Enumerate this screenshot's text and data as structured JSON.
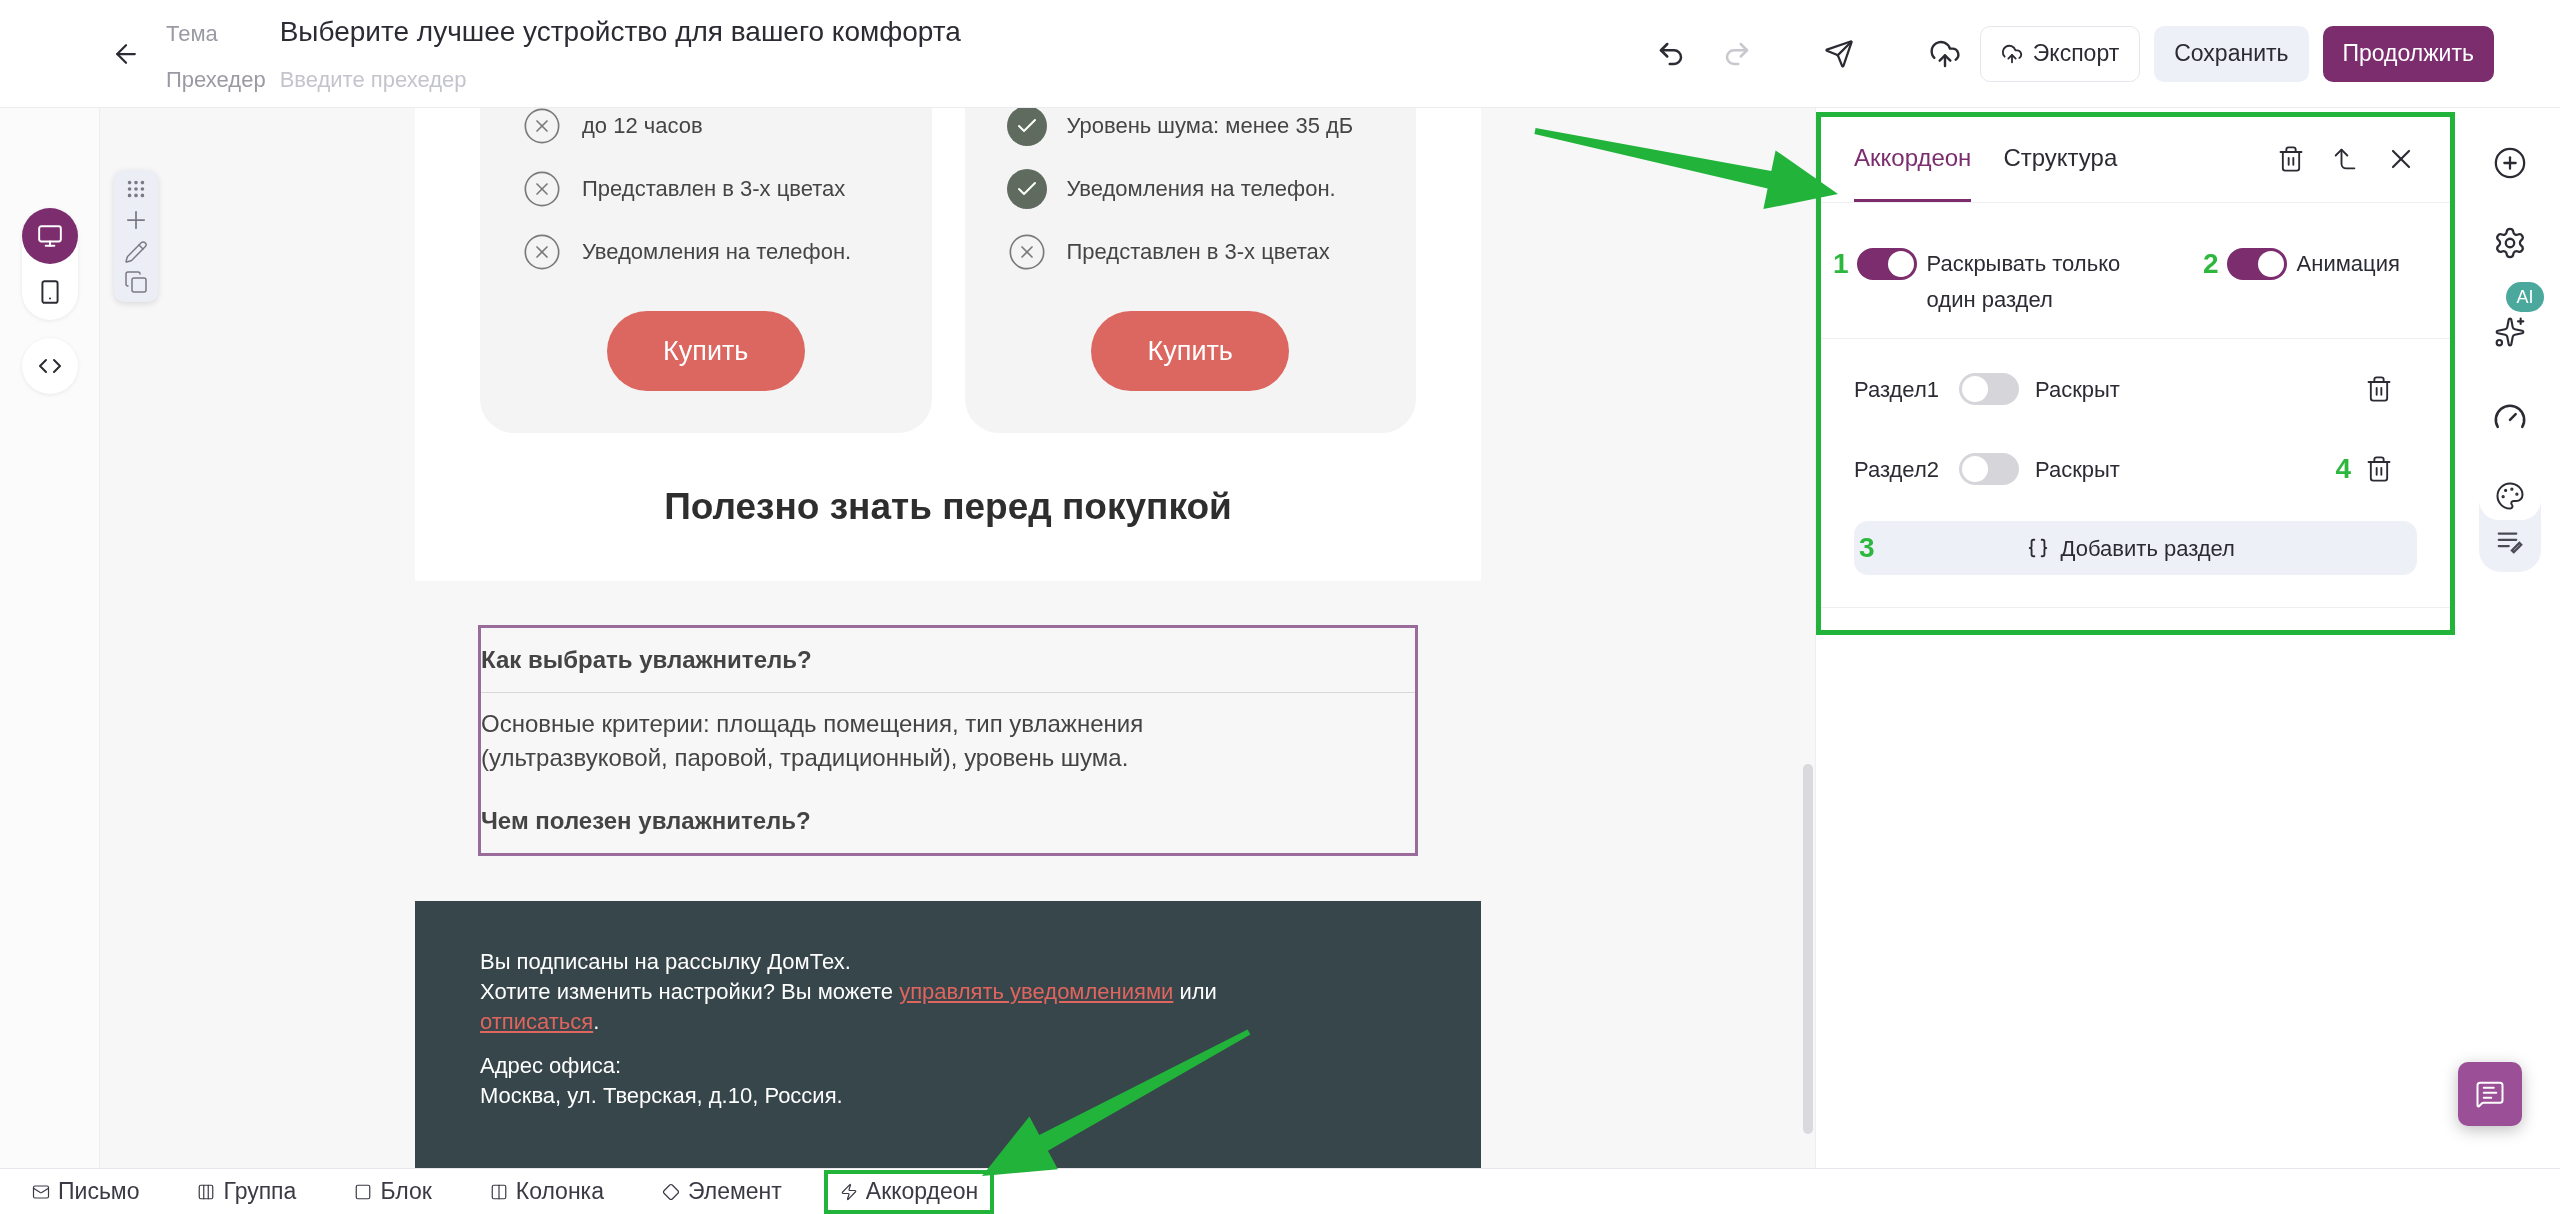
{
  "topbar": {
    "subject_label": "Тема",
    "subject": "Выберите лучшее устройство для вашего комфорта",
    "preheader_label": "Прехедер",
    "preheader_placeholder": "Введите прехедер",
    "redo_disabled": true,
    "buttons": [
      {
        "label": "Экспорт",
        "kind": "export"
      },
      {
        "label": "Сохранить",
        "kind": "secondary"
      },
      {
        "label": "Продолжить",
        "kind": "primary"
      }
    ]
  },
  "devices": [
    {
      "kind": "desktop",
      "selected": true
    },
    {
      "kind": "mobile",
      "selected": false
    }
  ],
  "email": {
    "cards": [
      {
        "features": [
          {
            "text": "до 12 часов",
            "included": false
          },
          {
            "text": "Представлен в 3-х цветах",
            "included": false
          },
          {
            "text": "Уведомления на телефон.",
            "included": false
          }
        ],
        "button": "Купить"
      },
      {
        "features": [
          {
            "text": "Уровень шума: менее 35 дБ",
            "included": true
          },
          {
            "text": "Уведомления на телефон.",
            "included": true
          },
          {
            "text": "Представлен в 3-х цветах",
            "included": false
          }
        ],
        "button": "Купить"
      }
    ],
    "heading": "Полезно знать перед покупкой",
    "accordion": [
      {
        "title": "Как выбрать увлажнитель?",
        "body": "Основные критерии: площадь помещения, тип увлажнения (ультразвуковой, паровой, традиционный), уровень шума."
      },
      {
        "title": "Чем полезен увлажнитель?"
      }
    ],
    "footer": {
      "line1": "Вы подписаны на рассылку ДомТех.",
      "before": "Хотите изменить настройки? Вы можете ",
      "link1": "управлять уведомлениями",
      "middle": " или ",
      "link2": "отписаться",
      "after": ".",
      "address_label": "Адрес офиса:",
      "address": "Москва, ул. Тверская, д.10, Россия."
    }
  },
  "panel": {
    "tabs": [
      {
        "label": "Аккордеон",
        "selected": true
      },
      {
        "label": "Структура",
        "selected": false
      }
    ],
    "options": [
      {
        "label": "Раскрывать только один раздел",
        "on": true,
        "annotation": "1"
      },
      {
        "label": "Анимация",
        "on": true,
        "annotation": "2"
      }
    ],
    "sections": [
      {
        "name": "Раздел1",
        "state_label": "Раскрыт",
        "on": false
      },
      {
        "name": "Раздел2",
        "state_label": "Раскрыт",
        "on": false,
        "annotation": "4"
      }
    ],
    "add_button": {
      "label": "Добавить раздел",
      "annotation": "3"
    }
  },
  "right_rail": {
    "ai_badge": "AI"
  },
  "breadcrumbs": [
    {
      "label": "Письмо",
      "kind": "mail",
      "highlighted": false
    },
    {
      "label": "Группа",
      "kind": "group",
      "highlighted": false
    },
    {
      "label": "Блок",
      "kind": "block",
      "highlighted": false
    },
    {
      "label": "Колонка",
      "kind": "column",
      "highlighted": false
    },
    {
      "label": "Элемент",
      "kind": "element",
      "highlighted": false
    },
    {
      "label": "Аккордеон",
      "kind": "accordion",
      "highlighted": true
    }
  ]
}
